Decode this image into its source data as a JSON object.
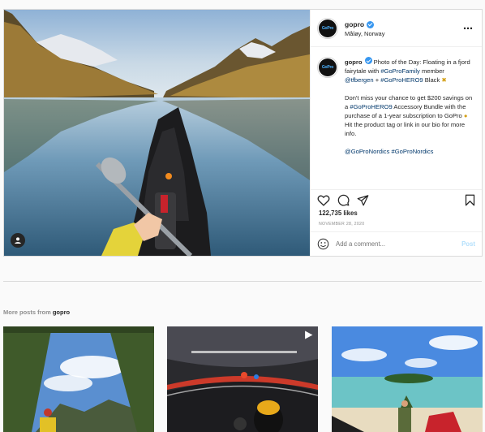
{
  "post": {
    "username": "gopro",
    "location": "Måløy, Norway",
    "caption": {
      "username": "gopro",
      "text1": "Photo of the Day: Floating in a fjord fairytale with ",
      "tag1": "#GoProFamily",
      "text2": " member ",
      "mention": "@tfbergen",
      "text3": " + ",
      "tag2": "#GoProHERO9",
      "text4": " Black ",
      "emoji1": "✖",
      "para2a": "Don't miss your chance to get $200 savings on a ",
      "tag3": "#GoProHERO9",
      "para2b": " Accessory Bundle with the purchase of a 1-year subscription to GoPro ",
      "emoji2": "●",
      "para2c": " Hit the product tag or link in our bio for more info.",
      "mention2": "@GoProNordics",
      "tag4": "#GoProNordics"
    },
    "likes": "122,735 likes",
    "date": "NOVEMBER 28, 2020",
    "comment_placeholder": "Add a comment...",
    "post_button": "Post",
    "avatar_text": "GoPro"
  },
  "more_posts": {
    "prefix": "More posts from ",
    "user": "gopro"
  },
  "icons": {
    "like": "heart-icon",
    "comment": "comment-icon",
    "share": "paper-plane-icon",
    "save": "bookmark-icon",
    "emoji": "smiley-icon",
    "more": "more-options-icon",
    "user_tag": "user-tag-icon",
    "video": "video-play-icon"
  },
  "colors": {
    "link": "#00376b",
    "verified": "#3897f0",
    "post_button": "#b2dffc"
  }
}
